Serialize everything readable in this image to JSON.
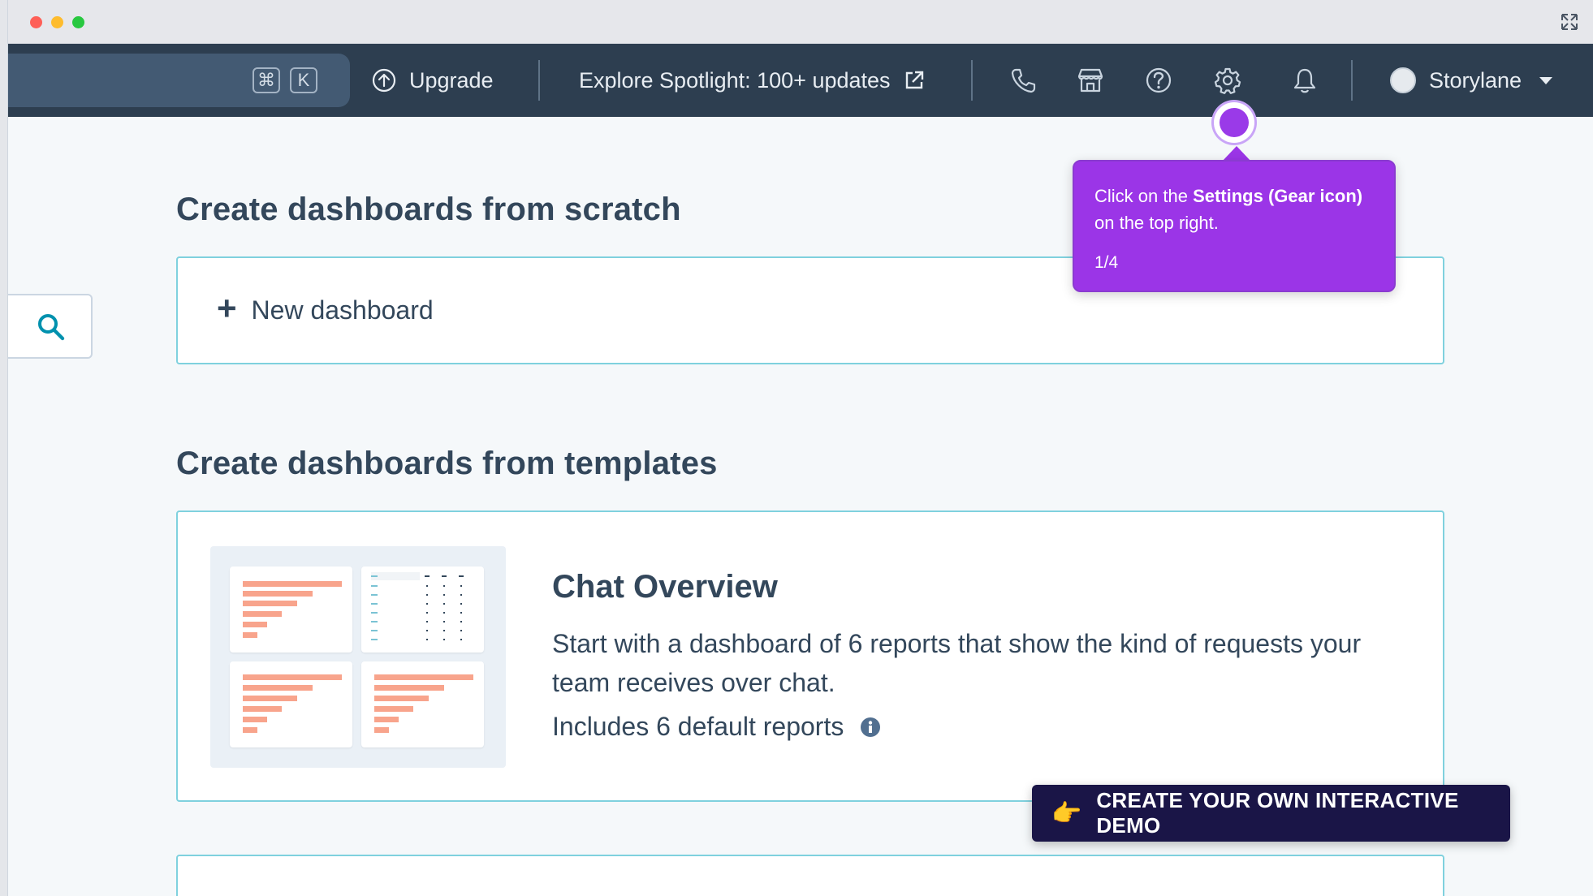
{
  "navbar": {
    "shortcut_keys": [
      "⌘",
      "K"
    ],
    "upgrade_label": "Upgrade",
    "spotlight_label": "Explore Spotlight: 100+ updates",
    "user_name": "Storylane"
  },
  "main": {
    "scratch_heading": "Create dashboards from scratch",
    "new_dashboard_plus": "+",
    "new_dashboard_label": "New dashboard",
    "templates_heading": "Create dashboards from templates",
    "template_card": {
      "title": "Chat Overview",
      "description": "Start with a dashboard of 6 reports that show the kind of requests your team receives over chat.",
      "includes": "Includes 6 default reports"
    }
  },
  "tooltip": {
    "text_before": "Click on the ",
    "text_bold": "Settings (Gear icon)",
    "text_after": " on the top right.",
    "step": "1/4"
  },
  "cta": {
    "emoji": "👉",
    "label": "CREATE YOUR OWN INTERACTIVE DEMO"
  },
  "colors": {
    "navbar_bg": "#2d3e50",
    "card_border": "#7fd1de",
    "tooltip_bg": "#9b35e7",
    "cta_bg": "#1a1547",
    "chart_bar": "#f8a48c",
    "search_accent": "#0091ae"
  },
  "icons": [
    "expand-icon",
    "upgrade-arrow-icon",
    "external-link-icon",
    "phone-icon",
    "marketplace-icon",
    "help-icon",
    "gear-icon",
    "bell-icon",
    "search-icon",
    "info-icon"
  ]
}
